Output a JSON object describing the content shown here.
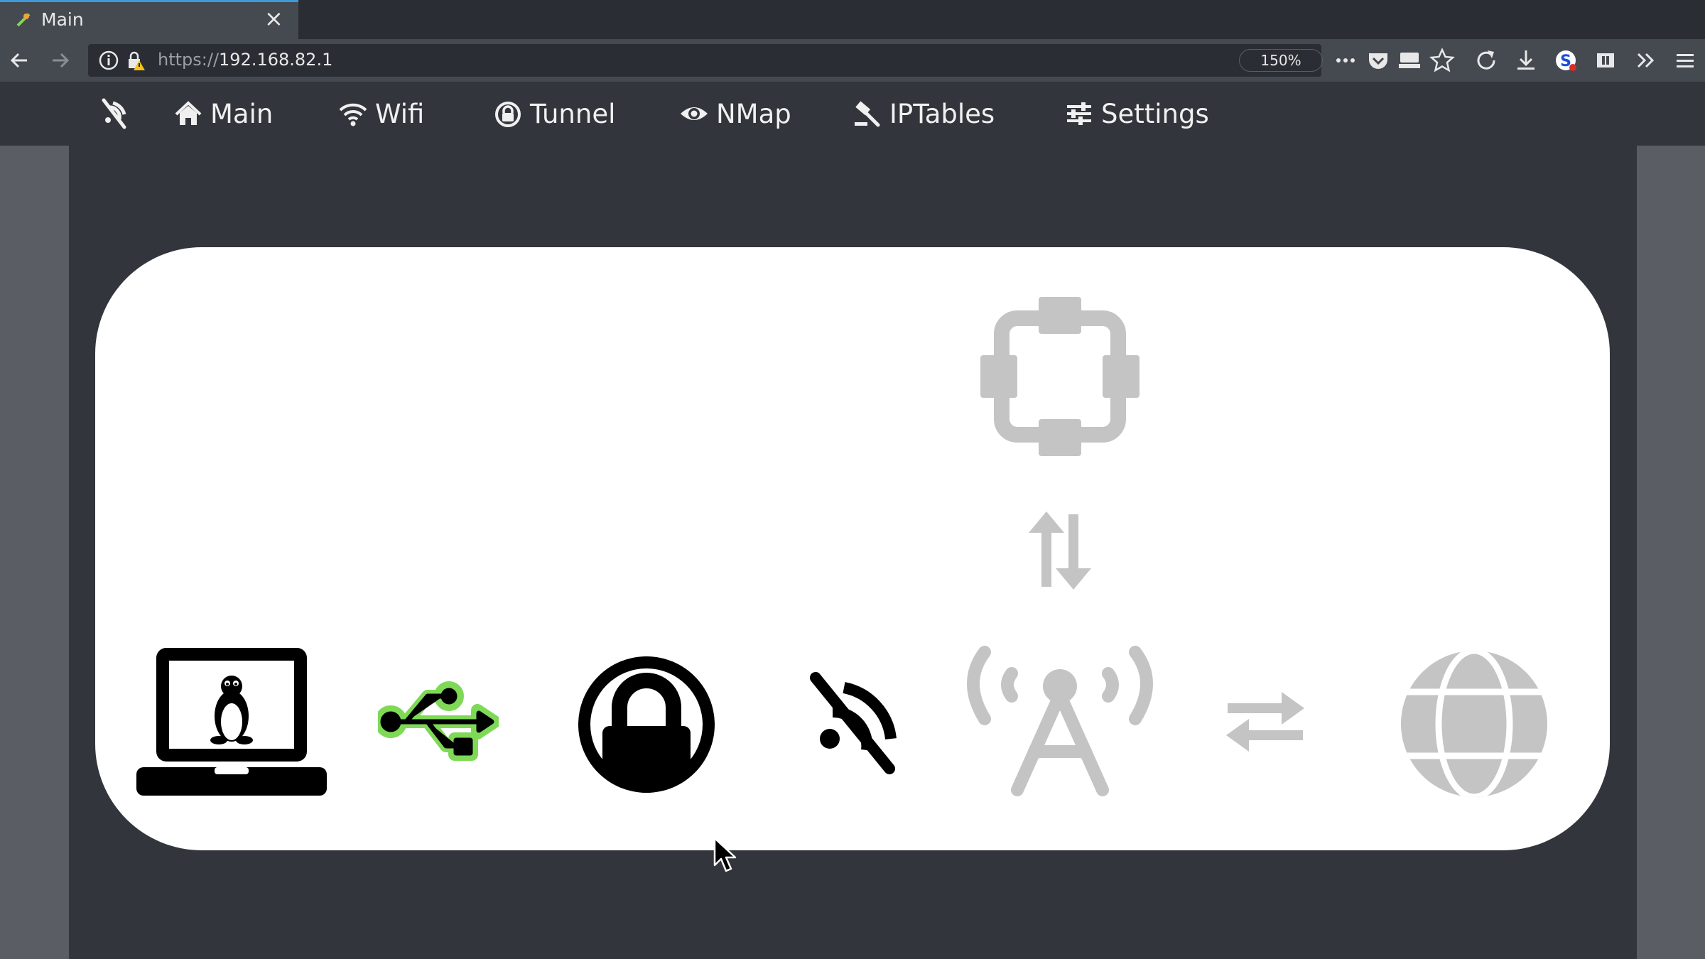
{
  "browser": {
    "tab_title": "Main",
    "url_scheme": "https://",
    "url_host": "192.168.82.1",
    "zoom": "150%",
    "icons": [
      "back-arrow-icon",
      "forward-arrow-icon",
      "info-icon",
      "insecure-lock-icon",
      "more-actions-icon",
      "pocket-icon",
      "reader-icon",
      "bookmark-star-icon",
      "reload-icon",
      "download-icon",
      "extension-s-icon",
      "extension-icon",
      "overflow-chevron-icon",
      "hamburger-menu-icon"
    ]
  },
  "nav": {
    "logo_icon": "signal-off-icon",
    "items": [
      {
        "label": "Main",
        "icon": "home-icon"
      },
      {
        "label": "Wifi",
        "icon": "wifi-icon"
      },
      {
        "label": "Tunnel",
        "icon": "lock-circle-icon"
      },
      {
        "label": "NMap",
        "icon": "eye-icon"
      },
      {
        "label": "IPTables",
        "icon": "gavel-icon"
      },
      {
        "label": "Settings",
        "icon": "sliders-icon"
      }
    ]
  },
  "diagram": {
    "nodes": [
      {
        "name": "linux-laptop",
        "active": true
      },
      {
        "name": "usb",
        "active": true,
        "accent": "#7ed957"
      },
      {
        "name": "vpn-lock",
        "active": true
      },
      {
        "name": "signal-off",
        "active": true
      },
      {
        "name": "antenna",
        "active": false
      },
      {
        "name": "exchange-arrows",
        "active": false
      },
      {
        "name": "globe",
        "active": false
      },
      {
        "name": "network-hub",
        "active": false
      },
      {
        "name": "vertical-arrows",
        "active": false
      }
    ],
    "colors": {
      "active": "#000000",
      "inactive": "#c4c4c4"
    }
  }
}
